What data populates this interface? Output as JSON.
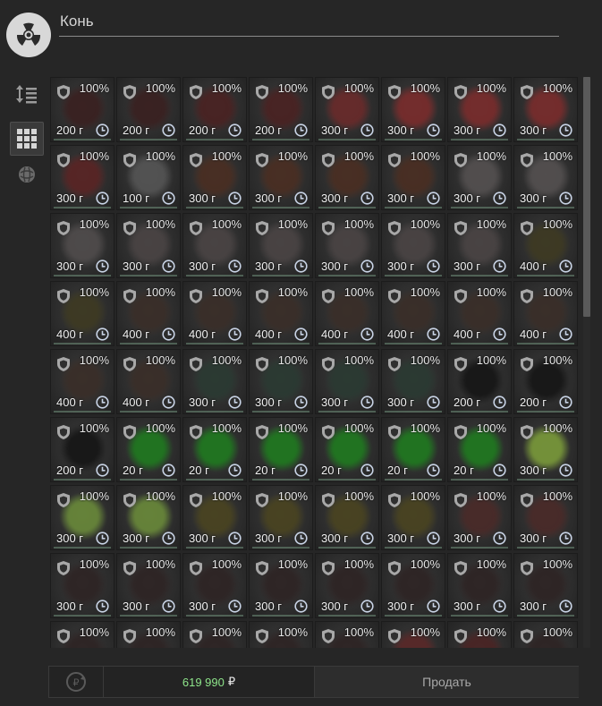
{
  "header": {
    "title": "Конь"
  },
  "side_buttons": [
    {
      "icon": "sort-icon"
    },
    {
      "icon": "grid-view-icon"
    },
    {
      "icon": "artifact-icon"
    }
  ],
  "grid": {
    "items": [
      {
        "dur": "100%",
        "w": "200 г",
        "c": "#3a2020"
      },
      {
        "dur": "100%",
        "w": "200 г",
        "c": "#3a2020"
      },
      {
        "dur": "100%",
        "w": "200 г",
        "c": "#4a2222"
      },
      {
        "dur": "100%",
        "w": "200 г",
        "c": "#4a2222"
      },
      {
        "dur": "100%",
        "w": "300 г",
        "c": "#6a2a2a"
      },
      {
        "dur": "100%",
        "w": "300 г",
        "c": "#7a2c2c"
      },
      {
        "dur": "100%",
        "w": "300 г",
        "c": "#7a2c2c"
      },
      {
        "dur": "100%",
        "w": "300 г",
        "c": "#7a2c2c"
      },
      {
        "dur": "100%",
        "w": "300 г",
        "c": "#5a2424"
      },
      {
        "dur": "100%",
        "w": "100 г",
        "c": "#555555"
      },
      {
        "dur": "100%",
        "w": "300 г",
        "c": "#4a2e22"
      },
      {
        "dur": "100%",
        "w": "300 г",
        "c": "#4a2e22"
      },
      {
        "dur": "100%",
        "w": "300 г",
        "c": "#4a2e22"
      },
      {
        "dur": "100%",
        "w": "300 г",
        "c": "#4a2e22"
      },
      {
        "dur": "100%",
        "w": "300 г",
        "c": "#545050"
      },
      {
        "dur": "100%",
        "w": "300 г",
        "c": "#545050"
      },
      {
        "dur": "100%",
        "w": "300 г",
        "c": "#504c4c"
      },
      {
        "dur": "100%",
        "w": "300 г",
        "c": "#4a4444"
      },
      {
        "dur": "100%",
        "w": "300 г",
        "c": "#4a4444"
      },
      {
        "dur": "100%",
        "w": "300 г",
        "c": "#4a4444"
      },
      {
        "dur": "100%",
        "w": "300 г",
        "c": "#4a4444"
      },
      {
        "dur": "100%",
        "w": "300 г",
        "c": "#4a4444"
      },
      {
        "dur": "100%",
        "w": "300 г",
        "c": "#4a4444"
      },
      {
        "dur": "100%",
        "w": "400 г",
        "c": "#3e3a22"
      },
      {
        "dur": "100%",
        "w": "400 г",
        "c": "#3e3a22"
      },
      {
        "dur": "100%",
        "w": "400 г",
        "c": "#3a2e28"
      },
      {
        "dur": "100%",
        "w": "400 г",
        "c": "#3a2e28"
      },
      {
        "dur": "100%",
        "w": "400 г",
        "c": "#3a2e28"
      },
      {
        "dur": "100%",
        "w": "400 г",
        "c": "#3a2e28"
      },
      {
        "dur": "100%",
        "w": "400 г",
        "c": "#3a2e28"
      },
      {
        "dur": "100%",
        "w": "400 г",
        "c": "#3a2e28"
      },
      {
        "dur": "100%",
        "w": "400 г",
        "c": "#3a2e28"
      },
      {
        "dur": "100%",
        "w": "400 г",
        "c": "#3a2e28"
      },
      {
        "dur": "100%",
        "w": "400 г",
        "c": "#3a2e28"
      },
      {
        "dur": "100%",
        "w": "300 г",
        "c": "#2a3a32"
      },
      {
        "dur": "100%",
        "w": "300 г",
        "c": "#2a3a32"
      },
      {
        "dur": "100%",
        "w": "300 г",
        "c": "#2a3a32"
      },
      {
        "dur": "100%",
        "w": "300 г",
        "c": "#2a3a32"
      },
      {
        "dur": "100%",
        "w": "200 г",
        "c": "#151515"
      },
      {
        "dur": "100%",
        "w": "200 г",
        "c": "#151515"
      },
      {
        "dur": "100%",
        "w": "200 г",
        "c": "#151515"
      },
      {
        "dur": "100%",
        "w": "20 г",
        "c": "#1f7a1f"
      },
      {
        "dur": "100%",
        "w": "20 г",
        "c": "#1f7a1f"
      },
      {
        "dur": "100%",
        "w": "20 г",
        "c": "#1f7a1f"
      },
      {
        "dur": "100%",
        "w": "20 г",
        "c": "#1f7a1f"
      },
      {
        "dur": "100%",
        "w": "20 г",
        "c": "#1f7a1f"
      },
      {
        "dur": "100%",
        "w": "20 г",
        "c": "#1f7a1f"
      },
      {
        "dur": "100%",
        "w": "300 г",
        "c": "#7a9a3a"
      },
      {
        "dur": "100%",
        "w": "300 г",
        "c": "#6a8a3a"
      },
      {
        "dur": "100%",
        "w": "300 г",
        "c": "#6a8a3a"
      },
      {
        "dur": "100%",
        "w": "300 г",
        "c": "#4a4420"
      },
      {
        "dur": "100%",
        "w": "300 г",
        "c": "#4a4420"
      },
      {
        "dur": "100%",
        "w": "300 г",
        "c": "#4a4420"
      },
      {
        "dur": "100%",
        "w": "300 г",
        "c": "#4a4420"
      },
      {
        "dur": "100%",
        "w": "300 г",
        "c": "#4a2a28"
      },
      {
        "dur": "100%",
        "w": "300 г",
        "c": "#4a2a28"
      },
      {
        "dur": "100%",
        "w": "300 г",
        "c": "#2e2424"
      },
      {
        "dur": "100%",
        "w": "300 г",
        "c": "#2e2424"
      },
      {
        "dur": "100%",
        "w": "300 г",
        "c": "#2e2424"
      },
      {
        "dur": "100%",
        "w": "300 г",
        "c": "#2e2424"
      },
      {
        "dur": "100%",
        "w": "300 г",
        "c": "#2e2424"
      },
      {
        "dur": "100%",
        "w": "300 г",
        "c": "#2e2424"
      },
      {
        "dur": "100%",
        "w": "300 г",
        "c": "#2e2424"
      },
      {
        "dur": "100%",
        "w": "300 г",
        "c": "#2e2424"
      },
      {
        "dur": "100%",
        "w": "",
        "c": "#2e2424"
      },
      {
        "dur": "100%",
        "w": "",
        "c": "#2e2424"
      },
      {
        "dur": "100%",
        "w": "",
        "c": "#2e2424"
      },
      {
        "dur": "100%",
        "w": "",
        "c": "#2e2424"
      },
      {
        "dur": "100%",
        "w": "",
        "c": "#2e2424"
      },
      {
        "dur": "100%",
        "w": "",
        "c": "#5a2828"
      },
      {
        "dur": "100%",
        "w": "",
        "c": "#4a2424"
      },
      {
        "dur": "100%",
        "w": "",
        "c": "#2e2424"
      }
    ]
  },
  "footer": {
    "money_value": "619 990",
    "currency": "₽",
    "sell_label": "Продать"
  },
  "scrollbar": {
    "position": 0
  }
}
